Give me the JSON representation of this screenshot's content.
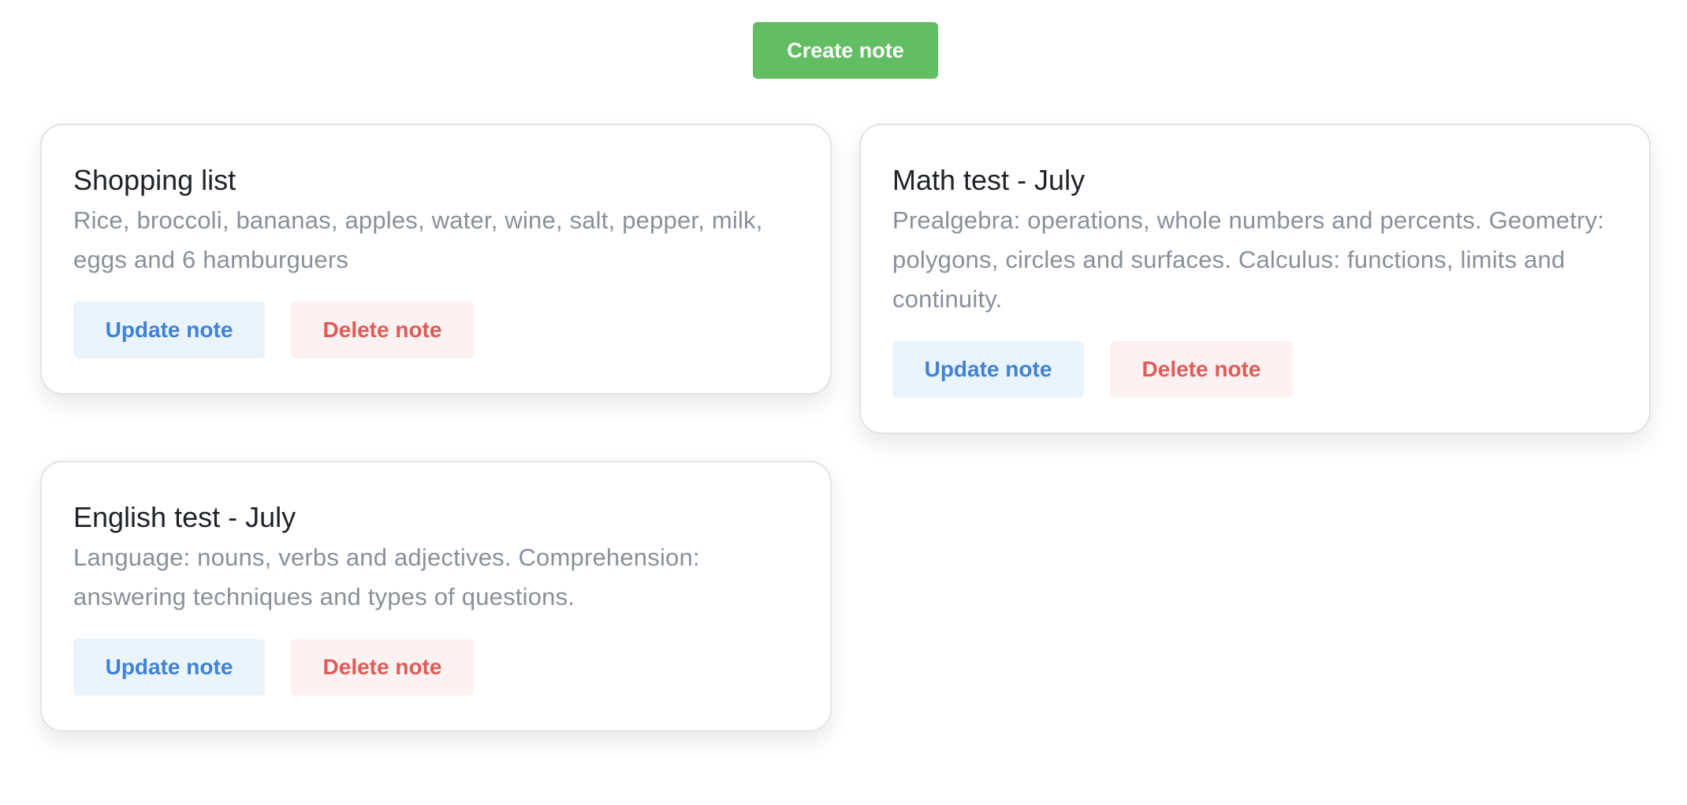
{
  "toolbar": {
    "create_label": "Create note"
  },
  "notes": [
    {
      "title": "Shopping list",
      "body": "Rice, broccoli, bananas, apples, water, wine, salt, pepper, milk, eggs and 6 hamburguers",
      "update_label": "Update note",
      "delete_label": "Delete note"
    },
    {
      "title": "Math test - July",
      "body": "Prealgebra: operations, whole numbers and percents. Geometry: polygons, circles and surfaces. Calculus: functions, limits and continuity.",
      "update_label": "Update note",
      "delete_label": "Delete note"
    },
    {
      "title": "English test - July",
      "body": "Language: nouns, verbs and adjectives. Comprehension: answering techniques and types of questions.",
      "update_label": "Update note",
      "delete_label": "Delete note"
    }
  ],
  "colors": {
    "create_button": "#63bd63",
    "update_text": "#3f82d6",
    "update_bg": "#eaf4fd",
    "delete_text": "#e05b55",
    "delete_bg": "#fdf1f1",
    "title_text": "#1f2327",
    "body_text": "#8a9099"
  }
}
